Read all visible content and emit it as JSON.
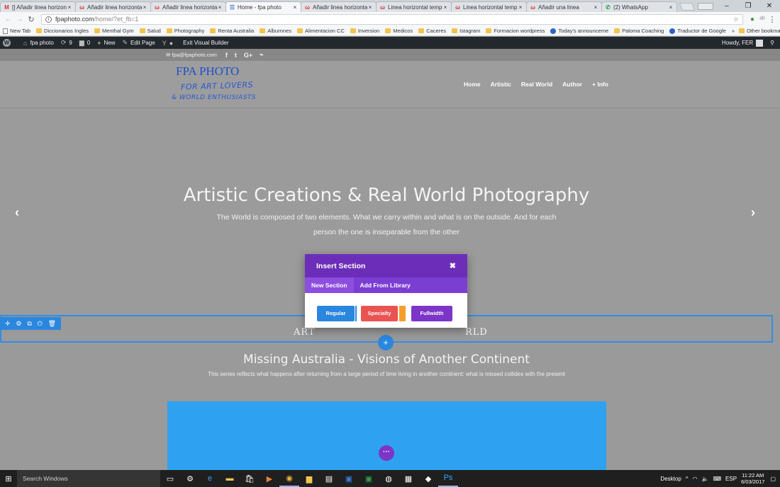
{
  "browser": {
    "tabs": [
      {
        "icon": "M",
        "icon_color": "#d93025",
        "title": "[] Añadir linea horizonta"
      },
      {
        "icon": "ω",
        "icon_color": "#d93025",
        "title": "Añadir linea horizontal"
      },
      {
        "icon": "ω",
        "icon_color": "#d93025",
        "title": "Añadir linea horizontal"
      },
      {
        "icon": "☰",
        "icon_color": "#3b78c4",
        "title": "Home - fpa photo",
        "active": true
      },
      {
        "icon": "ω",
        "icon_color": "#d93025",
        "title": "Añadir linea horizontal"
      },
      {
        "icon": "ω",
        "icon_color": "#d93025",
        "title": "Linea horizontal templa"
      },
      {
        "icon": "ω",
        "icon_color": "#d93025",
        "title": "Linea horizontal templa"
      },
      {
        "icon": "ω",
        "icon_color": "#d93025",
        "title": "Añadir una linea"
      },
      {
        "icon": "✆",
        "icon_color": "#25a244",
        "title": "(2) WhatsApp"
      }
    ],
    "address": {
      "host": "fpaphoto.com",
      "path": "/home/?et_fb=1"
    },
    "window": {
      "minimize": "–",
      "maximize": "❐",
      "close": "✕"
    },
    "bookmarks": [
      {
        "type": "page",
        "label": "New Tab"
      },
      {
        "type": "folder",
        "label": "Diccionarios Ingles"
      },
      {
        "type": "folder",
        "label": "Menthal Gym"
      },
      {
        "type": "folder",
        "label": "Salud"
      },
      {
        "type": "folder",
        "label": "Photography"
      },
      {
        "type": "folder",
        "label": "Renta Australia"
      },
      {
        "type": "folder",
        "label": "Alburnnes"
      },
      {
        "type": "folder",
        "label": "Alimentacion CC"
      },
      {
        "type": "folder",
        "label": "Inversion"
      },
      {
        "type": "folder",
        "label": "Medicos"
      },
      {
        "type": "folder",
        "label": "Caceres"
      },
      {
        "type": "folder",
        "label": "Istagram"
      },
      {
        "type": "folder",
        "label": "Formacion wordpress"
      },
      {
        "type": "circle",
        "label": "Today's announceme"
      },
      {
        "type": "folder",
        "label": "Paloma Coaching"
      },
      {
        "type": "circle",
        "label": "Traductor de Google"
      }
    ],
    "bookmarks_more": "»",
    "other_bookmarks": "Other bookmarks"
  },
  "wp_admin": {
    "site_name": "fpa photo",
    "updates": "9",
    "comments": "0",
    "new_label": "New",
    "edit_page": "Edit Page",
    "exit_builder": "Exit Visual Builder",
    "howdy": "Howdy, FER"
  },
  "site": {
    "topbar": {
      "email": "fpa@fpaphoto.com",
      "social": [
        "f",
        "t",
        "G+",
        "rss"
      ]
    },
    "logo": {
      "main": "FPA PHOTO",
      "line1": "FOR ART LOVERS",
      "line2": "& WORLD ENTHUSIASTS"
    },
    "nav": [
      "Home",
      "Artistic",
      "Real World",
      "Author",
      "+ Info"
    ],
    "hero": {
      "title": "Artistic Creations & Real World Photography",
      "text": "The World is composed of two elements. What we carry within and what is on the outside. And for each person the one is inseparable from the other"
    },
    "section_heading_left": "ART",
    "section_heading_right": "RLD",
    "gallery": {
      "title": "Missing Australia - Visions of Another Continent",
      "subtitle": "This series reflects what happens after returning from a large period of time living in another continent: what is missed collides with the present"
    }
  },
  "modal": {
    "title": "Insert Section",
    "tabs": [
      "New Section",
      "Add From Library"
    ],
    "buttons": {
      "regular": "Regular",
      "specialty": "Specialty",
      "fullwidth": "Fullwidth"
    }
  },
  "taskbar": {
    "search": "Search Windows",
    "desktop": "Desktop",
    "lang": "ESP",
    "time": "11:22 AM",
    "date": "6/03/2017"
  },
  "colors": {
    "wp_purple": "#6c2eb9",
    "builder_blue": "#2b87dd",
    "specialty_red": "#e95453",
    "specialty_orange": "#f59e2d"
  }
}
